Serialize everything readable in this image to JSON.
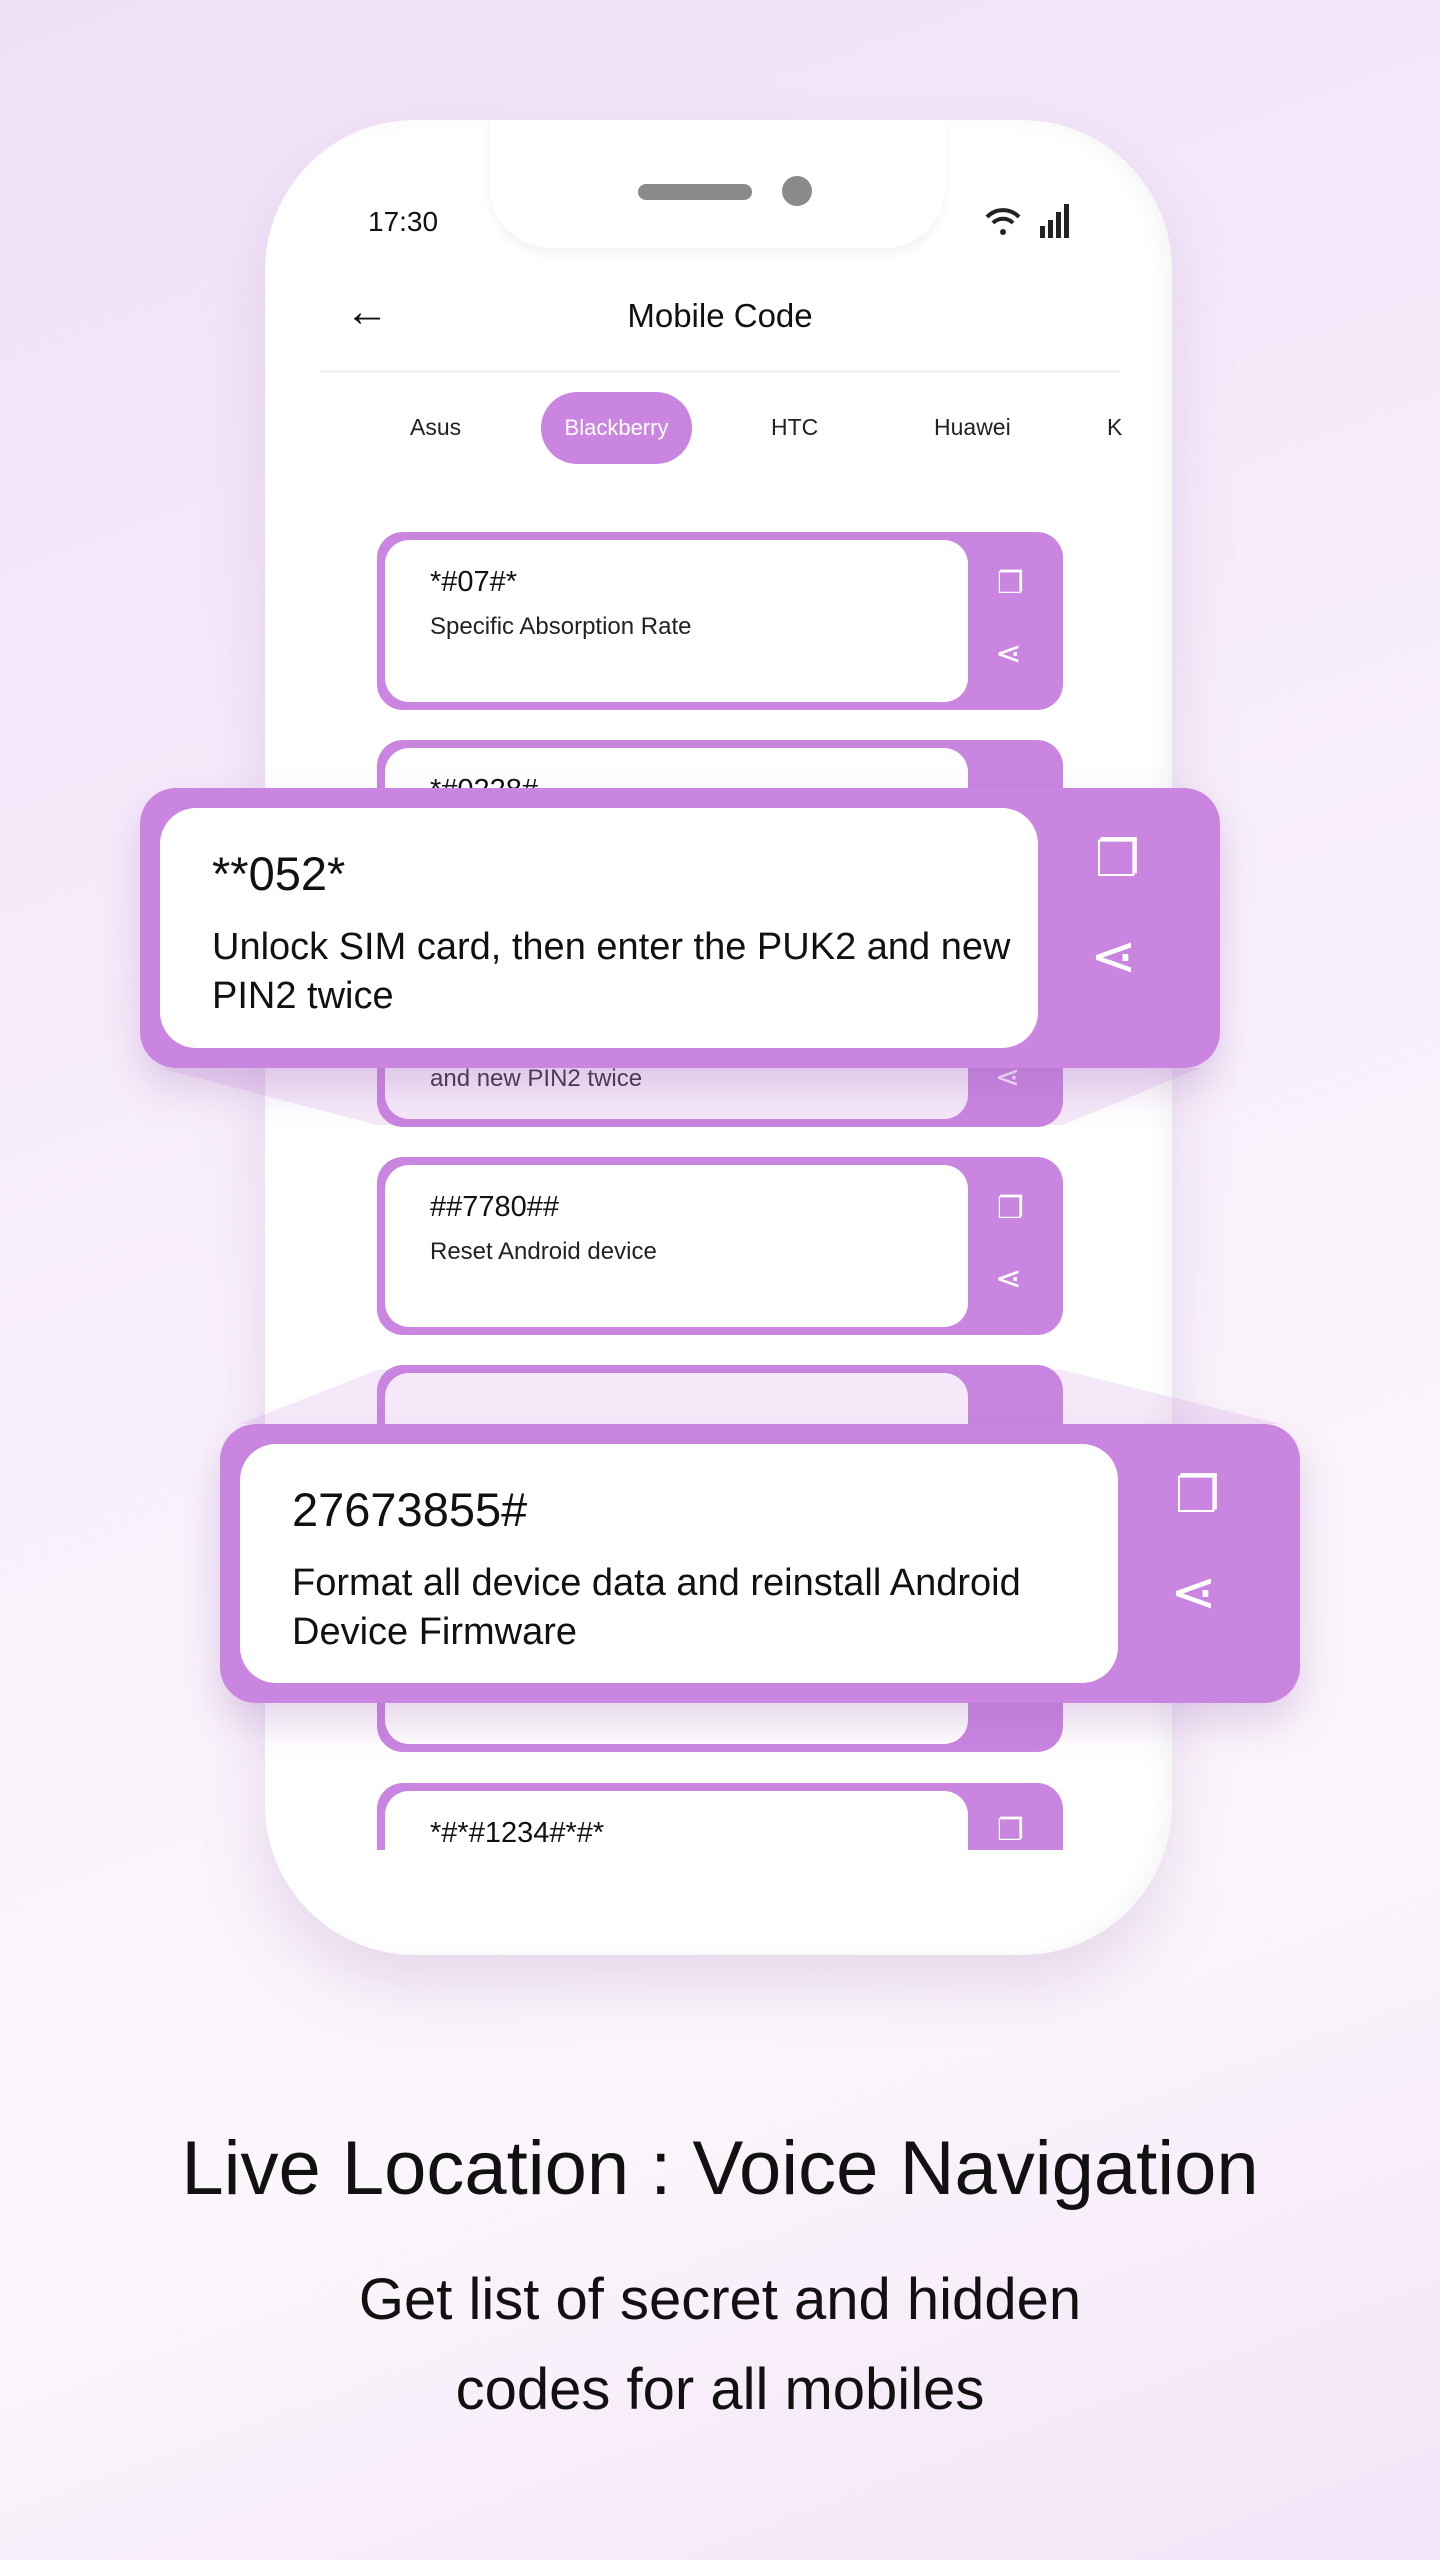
{
  "status_bar": {
    "time": "17:30",
    "wifi_icon": "wifi-icon",
    "signal_icon": "signal-icon"
  },
  "header": {
    "title": "Mobile Code",
    "back_icon": "arrow-left-icon"
  },
  "tabs": [
    {
      "label": "Asus"
    },
    {
      "label": "Blackberry",
      "selected": true
    },
    {
      "label": "HTC"
    },
    {
      "label": "Huawei"
    },
    {
      "label": "K"
    }
  ],
  "cards": [
    {
      "code": "*#07#*",
      "desc": "Specific Absorption Rate"
    },
    {
      "code": "*#0228#",
      "desc": "and new PIN2 twice"
    },
    {
      "code": "##7780##",
      "desc": "Reset Android device"
    },
    {
      "code": "",
      "desc": ""
    },
    {
      "code": "*#*#1234#*#*",
      "desc": ""
    }
  ],
  "popups": [
    {
      "code": "**052*",
      "desc": "Unlock SIM card, then enter the PUK2 and new PIN2 twice"
    },
    {
      "code": "27673855#",
      "desc": "Format all device data and reinstall Android Device Firmware"
    }
  ],
  "footer": {
    "title": "Live Location : Voice Navigation",
    "subtitle": "Get list of secret and hidden codes for all mobiles"
  },
  "colors": {
    "accent": "#c985e0"
  }
}
